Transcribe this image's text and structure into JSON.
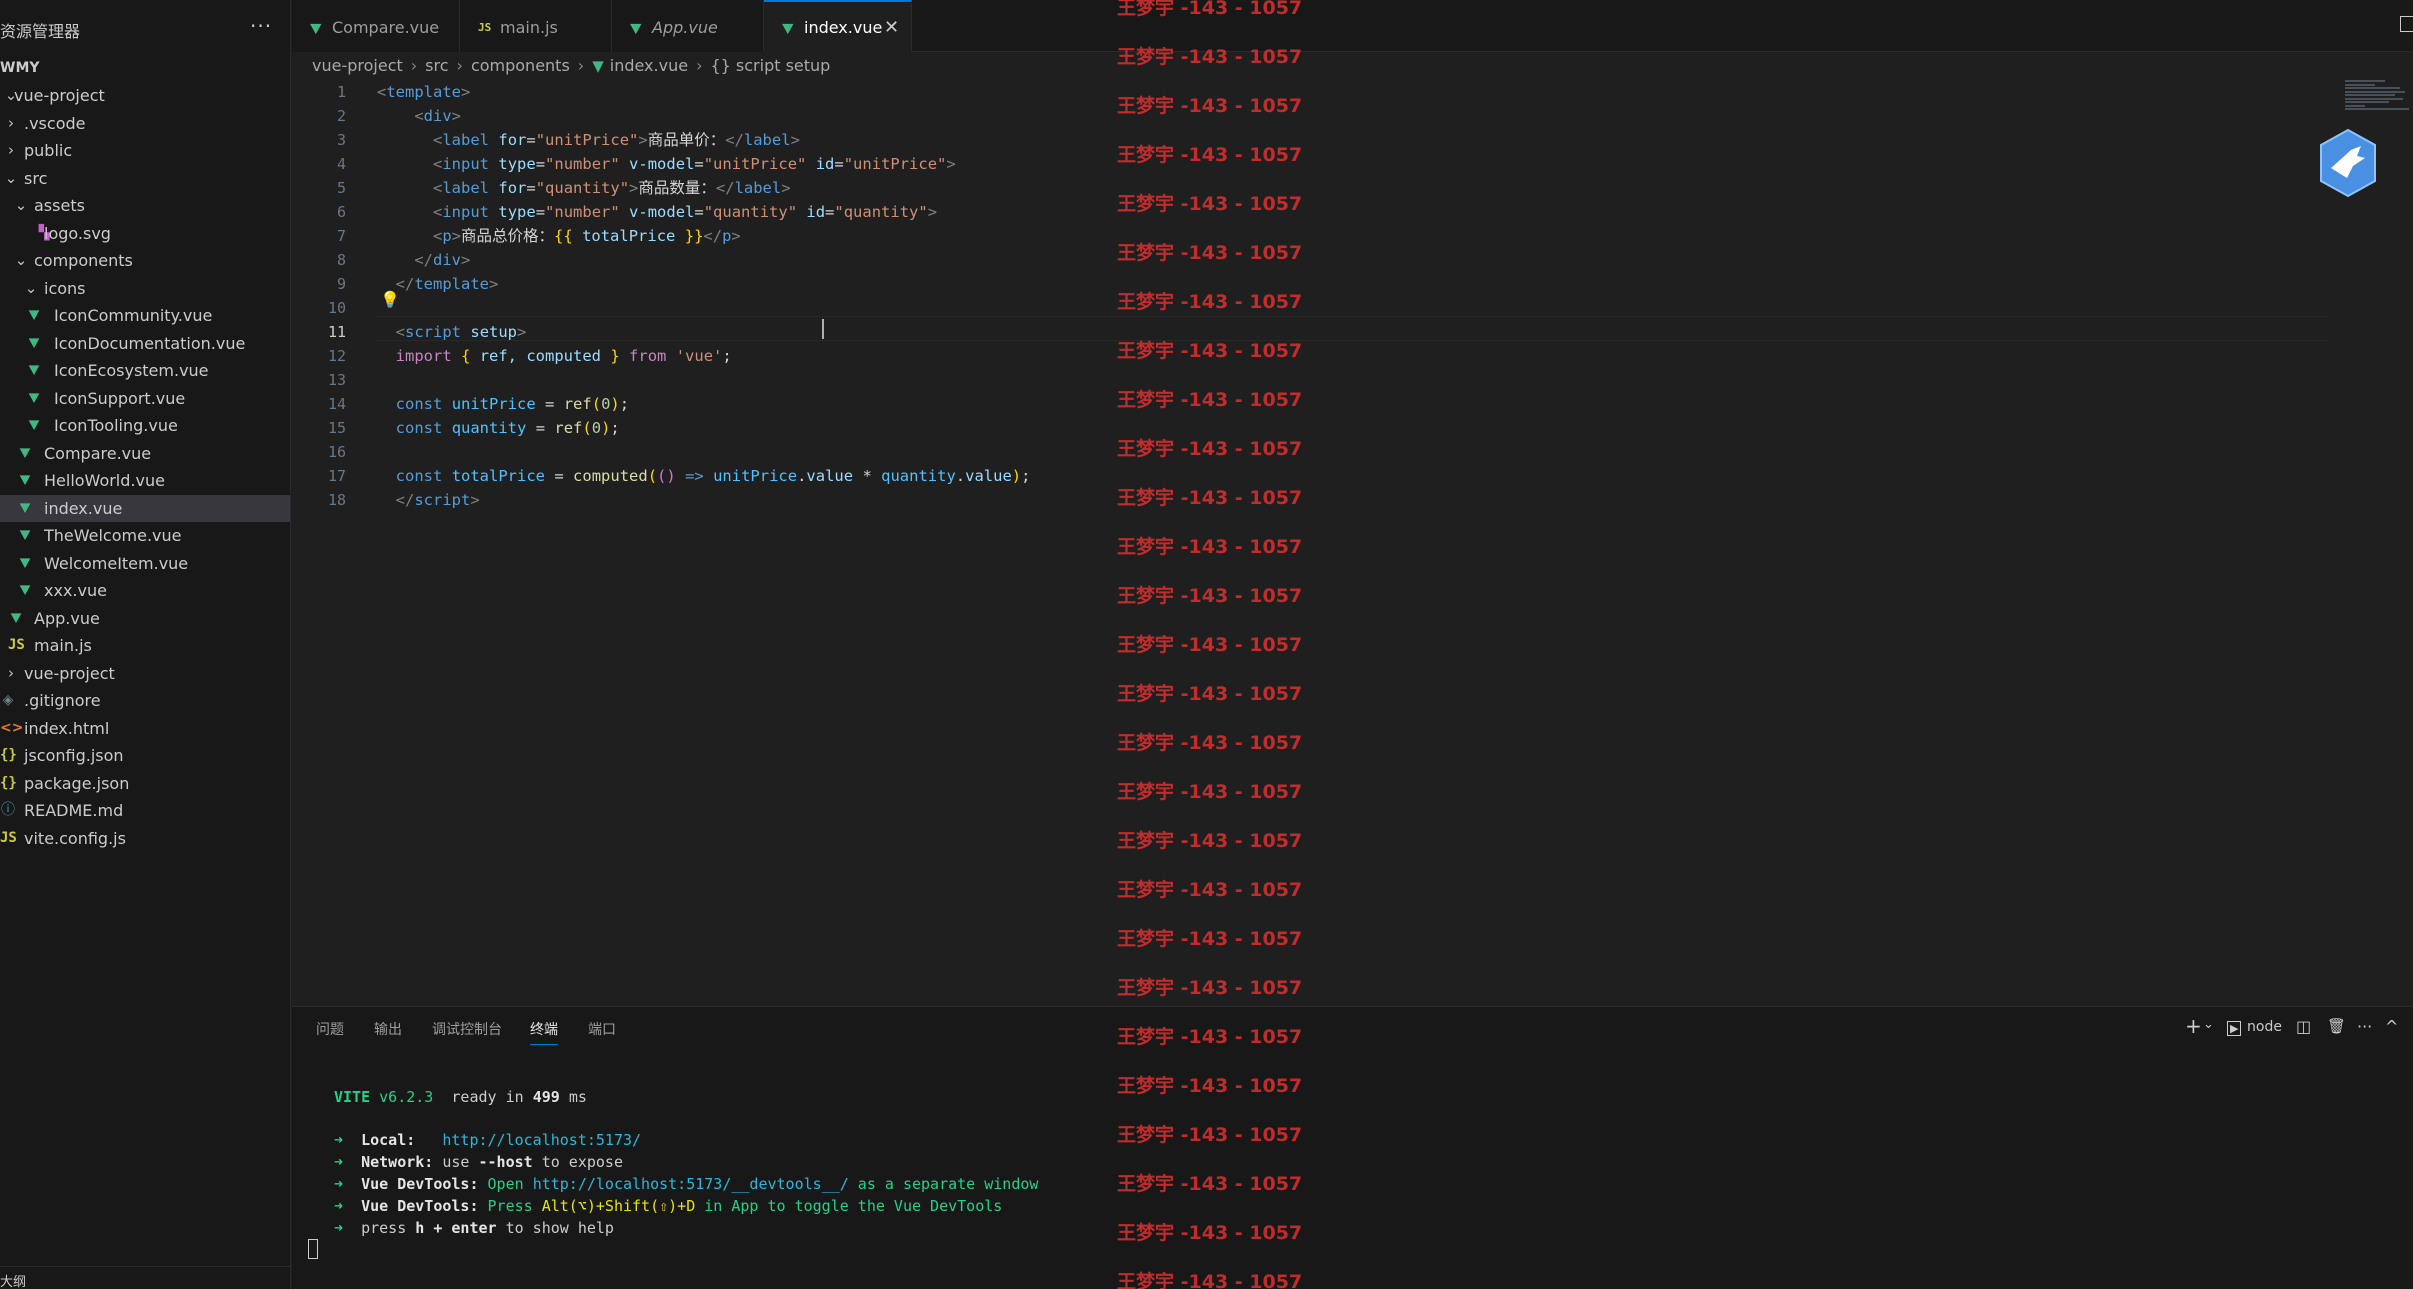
{
  "sidebar": {
    "title": "资源管理器",
    "more": "···",
    "workspace": "WMY",
    "items": [
      {
        "label": "vue-project",
        "chevron": "⌄",
        "icon": ""
      },
      {
        "label": ".vscode",
        "chevron": "›",
        "icon": ""
      },
      {
        "label": "public",
        "chevron": "›",
        "icon": ""
      },
      {
        "label": "src",
        "chevron": "⌄",
        "icon": ""
      },
      {
        "label": "assets",
        "chevron": "⌄",
        "icon": ""
      },
      {
        "label": "logo.svg",
        "chevron": "",
        "icon": "svg"
      },
      {
        "label": "components",
        "chevron": "⌄",
        "icon": ""
      },
      {
        "label": "icons",
        "chevron": "⌄",
        "icon": ""
      },
      {
        "label": "IconCommunity.vue",
        "chevron": "",
        "icon": "vue"
      },
      {
        "label": "IconDocumentation.vue",
        "chevron": "",
        "icon": "vue"
      },
      {
        "label": "IconEcosystem.vue",
        "chevron": "",
        "icon": "vue"
      },
      {
        "label": "IconSupport.vue",
        "chevron": "",
        "icon": "vue"
      },
      {
        "label": "IconTooling.vue",
        "chevron": "",
        "icon": "vue"
      },
      {
        "label": "Compare.vue",
        "chevron": "",
        "icon": "vue"
      },
      {
        "label": "HelloWorld.vue",
        "chevron": "",
        "icon": "vue"
      },
      {
        "label": "index.vue",
        "chevron": "",
        "icon": "vue"
      },
      {
        "label": "TheWelcome.vue",
        "chevron": "",
        "icon": "vue"
      },
      {
        "label": "WelcomeItem.vue",
        "chevron": "",
        "icon": "vue"
      },
      {
        "label": "xxx.vue",
        "chevron": "",
        "icon": "vue"
      },
      {
        "label": "App.vue",
        "chevron": "",
        "icon": "vue"
      },
      {
        "label": "main.js",
        "chevron": "",
        "icon": "js"
      },
      {
        "label": "vue-project",
        "chevron": "›",
        "icon": ""
      },
      {
        "label": ".gitignore",
        "chevron": "",
        "icon": "git"
      },
      {
        "label": "index.html",
        "chevron": "",
        "icon": "html"
      },
      {
        "label": "jsconfig.json",
        "chevron": "",
        "icon": "json"
      },
      {
        "label": "package.json",
        "chevron": "",
        "icon": "json"
      },
      {
        "label": "README.md",
        "chevron": "",
        "icon": "md"
      },
      {
        "label": "vite.config.js",
        "chevron": "",
        "icon": "js"
      }
    ],
    "icon_glyphs": {
      "vue": "▼",
      "js": "JS",
      "html": "<>",
      "json": "{}",
      "md": "ⓘ",
      "svg": "▚",
      "git": "◈"
    },
    "outline": "大纲"
  },
  "tabs": [
    {
      "label": "Compare.vue",
      "icon": "▼"
    },
    {
      "label": "main.js",
      "icon": "JS"
    },
    {
      "label": "App.vue",
      "icon": "▼"
    },
    {
      "label": "index.vue",
      "icon": "▼",
      "close": "✕"
    }
  ],
  "breadcrumb": {
    "p1": "vue-project",
    "p2": "src",
    "p3": "components",
    "p4": "index.vue",
    "p5": "{} script setup",
    "sep": "›"
  },
  "editor": {
    "line_numbers": [
      "1",
      "2",
      "3",
      "4",
      "5",
      "6",
      "7",
      "8",
      "9",
      "10",
      "11",
      "12",
      "13",
      "14",
      "15",
      "16",
      "17",
      "18"
    ],
    "code": {
      "l1": "template",
      "l2": "div",
      "l3_tag": "label",
      "l3_attr": "for",
      "l3_val": "\"unitPrice\"",
      "l3_text": "商品单价：",
      "l4_tag": "input",
      "l4_a1": "type",
      "l4_v1": "\"number\"",
      "l4_a2": "v-model",
      "l4_v2": "\"unitPrice\"",
      "l4_a3": "id",
      "l4_v3": "\"unitPrice\"",
      "l5_tag": "label",
      "l5_attr": "for",
      "l5_val": "\"quantity\"",
      "l5_text": "商品数量：",
      "l6_tag": "input",
      "l6_a1": "type",
      "l6_v1": "\"number\"",
      "l6_a2": "v-model",
      "l6_v2": "\"quantity\"",
      "l6_a3": "id",
      "l6_v3": "\"quantity\"",
      "l7_tag": "p",
      "l7_text": "商品总价格：",
      "l7_open": "{{",
      "l7_var": "totalPrice",
      "l7_close": "}}",
      "l8": "div",
      "l9": "template",
      "l11_tag": "script",
      "l11_attr": "setup",
      "l12_import": "import",
      "l12_b1": "{",
      "l12_names": " ref, computed ",
      "l12_b2": "}",
      "l12_from": "from",
      "l12_str": "'vue'",
      "l14_const": "const",
      "l14_var": "unitPrice",
      "l14_fn": "ref",
      "l14_num": "0",
      "l15_const": "const",
      "l15_var": "quantity",
      "l15_fn": "ref",
      "l15_num": "0",
      "l17_const": "const",
      "l17_var": "totalPrice",
      "l17_fn": "computed",
      "l17_arrow": "=>",
      "l17_a": "unitPrice",
      "l17_b": "quantity",
      "l17_prop": "value",
      "l18": "script"
    },
    "bulb": "💡"
  },
  "panel": {
    "tabs": [
      "问题",
      "输出",
      "调试控制台",
      "终端",
      "端口"
    ],
    "actions": {
      "add": "+",
      "dropdown": "⌄",
      "shell_icon": "▶",
      "shell": "node",
      "split": "◫",
      "trash": "🗑",
      "more": "···",
      "collapse": "^"
    },
    "terminal": {
      "vite": "VITE",
      "version": "v6.2.3",
      "ready": "ready in",
      "ms_val": "499",
      "ms": "ms",
      "arrow": "➜",
      "local_label": "Local:",
      "local_url": "http://localhost:5173/",
      "network_label": "Network:",
      "network_use": "use",
      "network_flag": "--host",
      "network_tail": "to expose",
      "dev1_label": "Vue DevTools:",
      "dev1_open": "Open",
      "dev1_url": "http://localhost:5173/__devtools__/",
      "dev1_tail": "as a separate window",
      "dev2_label": "Vue DevTools:",
      "dev2_press": "Press",
      "dev2_keys": "Alt(⌥)+Shift(⇧)+D",
      "dev2_tail": "in App to toggle the Vue DevTools",
      "help_press": "press",
      "help_keys": "h + enter",
      "help_tail": "to show help"
    }
  },
  "watermark": "王梦宇 -143 - 1057",
  "colors": {
    "accent": "#0078d4",
    "watermark": "#d32f2f",
    "vue": "#41b883"
  }
}
